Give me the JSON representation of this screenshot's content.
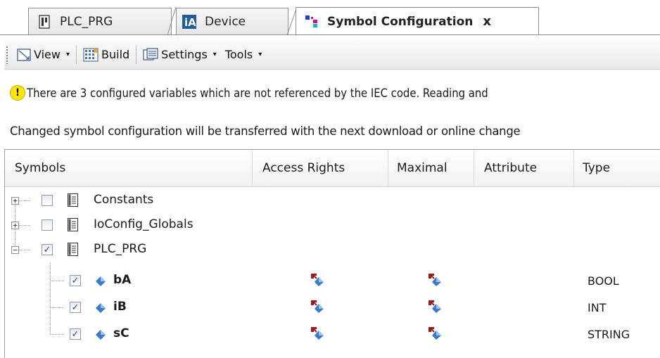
{
  "tabs": [
    {
      "label": "PLC_PRG",
      "icon": "program-icon"
    },
    {
      "label": "Device",
      "icon": "device-icon"
    },
    {
      "label": "Symbol Configuration",
      "icon": "symbol-config-icon",
      "close": "x"
    }
  ],
  "toolbar": {
    "view_label": "View",
    "build_label": "Build",
    "settings_label": "Settings",
    "tools_label": "Tools",
    "caret": "▾"
  },
  "info": {
    "warning_icon": "!",
    "warning_text": "There are 3 configured variables which are not referenced by the IEC code. Reading and",
    "changed_text": "Changed symbol configuration will be transferred with the next download or online change"
  },
  "grid": {
    "headers": [
      "Symbols",
      "Access Rights",
      "Maximal",
      "Attribute",
      "Type"
    ],
    "rows": [
      {
        "name": "Constants",
        "level": 0,
        "expander": "+",
        "checked": false,
        "type": ""
      },
      {
        "name": "IoConfig_Globals",
        "level": 0,
        "expander": "+",
        "checked": false,
        "type": ""
      },
      {
        "name": "PLC_PRG",
        "level": 0,
        "expander": "−",
        "checked": true,
        "type": ""
      },
      {
        "name": "bA",
        "level": 1,
        "checked": true,
        "type": "BOOL"
      },
      {
        "name": "iB",
        "level": 1,
        "checked": true,
        "type": "INT"
      },
      {
        "name": "sC",
        "level": 1,
        "checked": true,
        "type": "STRING"
      }
    ],
    "checkmark": "✓"
  },
  "colors": {
    "warning_yellow": "#ffe600",
    "var_blue": "#3a78c9",
    "access_red": "#9b1b1b"
  }
}
